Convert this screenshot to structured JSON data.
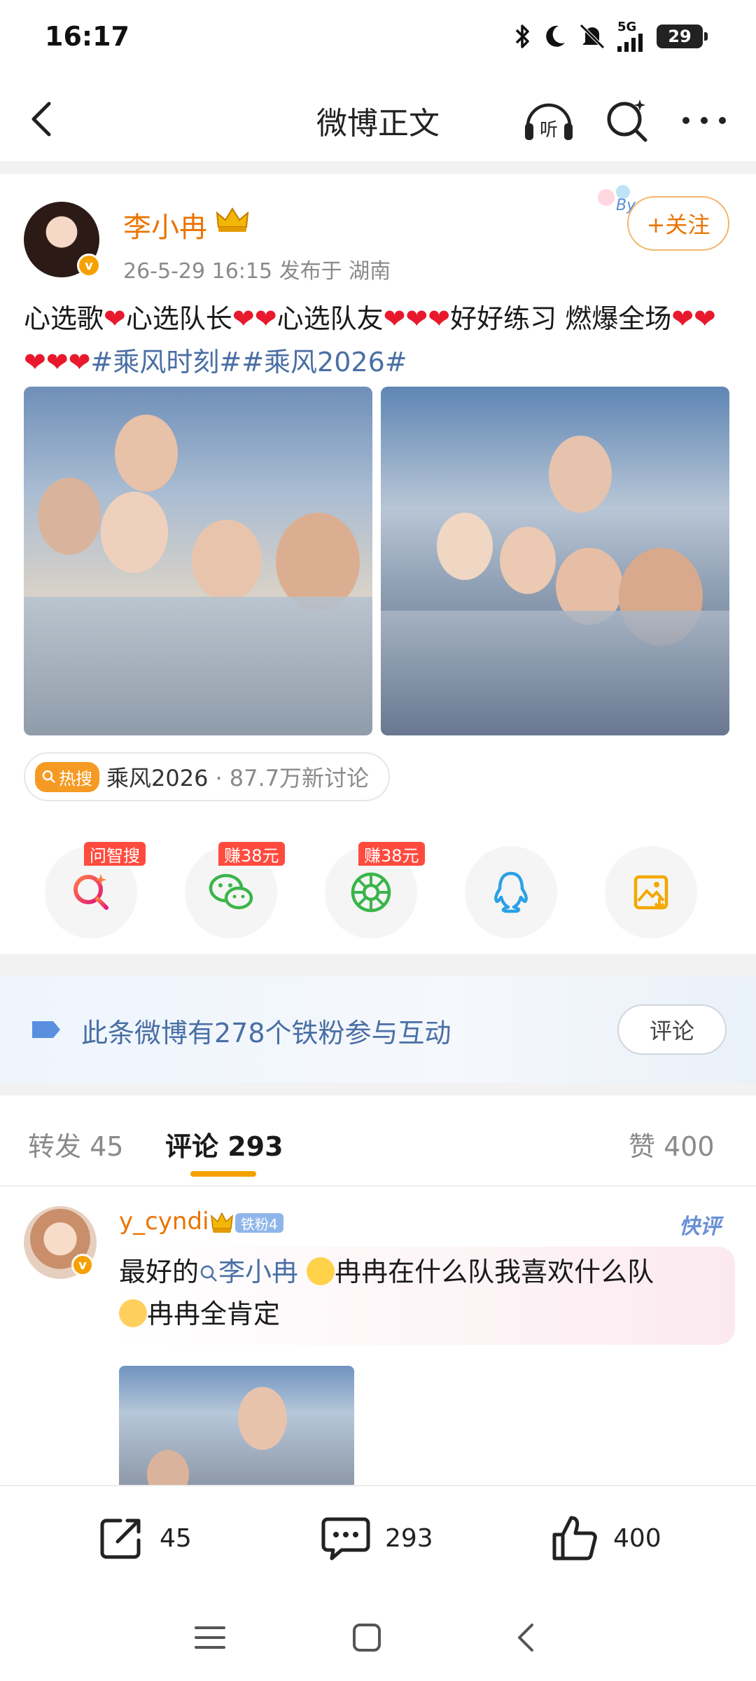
{
  "status_bar": {
    "time": "16:17",
    "network": "5G",
    "battery": "29",
    "icons": [
      "bluetooth-icon",
      "moon-icon",
      "mute-icon",
      "signal-icon",
      "battery-icon"
    ]
  },
  "nav": {
    "title": "微博正文",
    "listen_label": "听",
    "icons": [
      "back-icon",
      "listen-icon",
      "search-icon",
      "more-icon"
    ]
  },
  "post": {
    "author": "李小冉",
    "verified_badge": "v",
    "meta": "26-5-29 16:15   发布于 湖南",
    "follow_label": "+关注",
    "text_segments": [
      {
        "t": "心选歌",
        "k": "text"
      },
      {
        "t": "❤",
        "k": "heart"
      },
      {
        "t": "心选队长",
        "k": "text"
      },
      {
        "t": "❤❤",
        "k": "heart"
      },
      {
        "t": "心选队友",
        "k": "text"
      },
      {
        "t": "❤❤❤",
        "k": "heart"
      },
      {
        "t": "好好练习 燃爆全场",
        "k": "text"
      },
      {
        "t": "❤❤❤❤❤",
        "k": "heart"
      },
      {
        "t": "#乘风时刻#",
        "k": "topic"
      },
      {
        "t": "#乘风2026#",
        "k": "topic"
      }
    ]
  },
  "hot_tag": {
    "badge": "热搜",
    "topic": "乘风2026",
    "count": "· 87.7万新讨论"
  },
  "share": [
    {
      "id": "ask",
      "badge": "问智搜",
      "icon": "ask-search-icon"
    },
    {
      "id": "wechat",
      "badge": "赚38元",
      "icon": "wechat-icon"
    },
    {
      "id": "moments",
      "badge": "赚38元",
      "icon": "moments-icon"
    },
    {
      "id": "qq",
      "badge": "",
      "icon": "qq-icon"
    },
    {
      "id": "save",
      "badge": "",
      "icon": "save-image-icon"
    }
  ],
  "fans_banner": {
    "text": "此条微博有278个铁粉参与互动",
    "button": "评论"
  },
  "tabs": {
    "repost": "转发 45",
    "comments": "评论 293",
    "likes": "赞 400"
  },
  "comment": {
    "user": "y_cyndi",
    "fan_badge": "铁粉4",
    "tag": "快评",
    "prefix": "最好的",
    "mention": "李小冉",
    "line1_rest": "冉冉在什么队我喜欢什么队",
    "line2": "冉冉全肯定"
  },
  "actions": {
    "repost_count": "45",
    "comment_count": "293",
    "like_count": "400"
  },
  "colors": {
    "accent": "#eb7300",
    "link": "#4a6fa5",
    "heart": "#e8192c",
    "badge_red": "#ff4b3e"
  }
}
